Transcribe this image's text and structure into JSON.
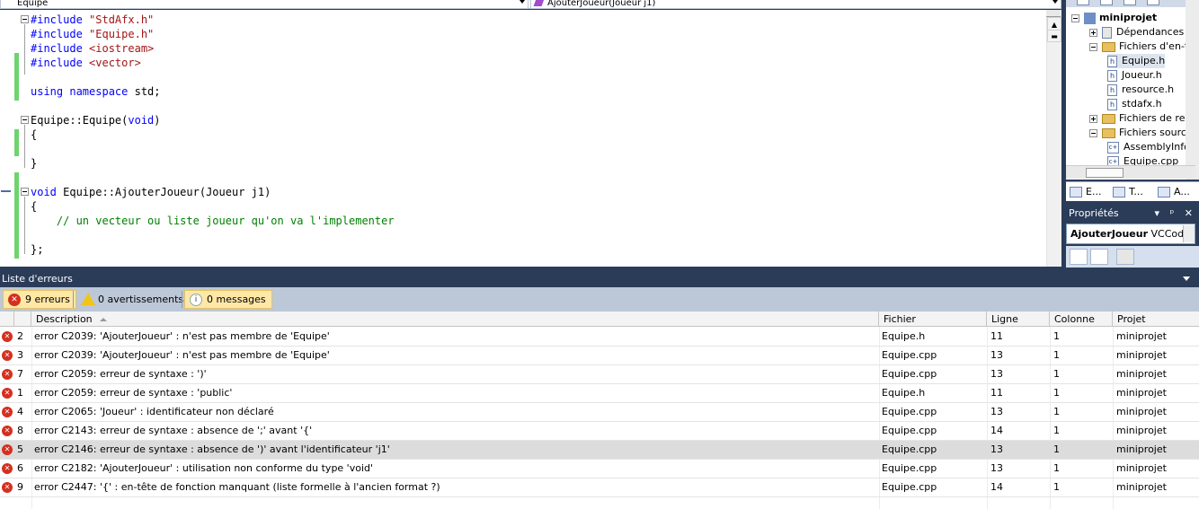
{
  "navbar": {
    "class_combo": "Equipe",
    "member_combo": "AjouterJoueur(Joueur j1)"
  },
  "editor": {
    "lines": [
      [
        {
          "t": "#include ",
          "c": "kw"
        },
        {
          "t": "\"StdAfx.h\"",
          "c": "st"
        }
      ],
      [
        {
          "t": "#include ",
          "c": "kw"
        },
        {
          "t": "\"Equipe.h\"",
          "c": "st"
        }
      ],
      [
        {
          "t": "#include ",
          "c": "kw"
        },
        {
          "t": "<iostream>",
          "c": "st"
        }
      ],
      [
        {
          "t": "#include ",
          "c": "kw"
        },
        {
          "t": "<vector>",
          "c": "st"
        }
      ],
      [],
      [
        {
          "t": "using namespace ",
          "c": "kw"
        },
        {
          "t": "std;",
          "c": ""
        }
      ],
      [],
      [
        {
          "t": "Equipe::Equipe(",
          "c": ""
        },
        {
          "t": "void",
          "c": "kw"
        },
        {
          "t": ")",
          "c": ""
        }
      ],
      [
        {
          "t": "{",
          "c": ""
        }
      ],
      [],
      [
        {
          "t": "}",
          "c": ""
        }
      ],
      [],
      [
        {
          "t": "void",
          "c": "kw"
        },
        {
          "t": " Equipe::AjouterJoueur(Joueur j1)",
          "c": ""
        }
      ],
      [
        {
          "t": "{",
          "c": ""
        }
      ],
      [
        {
          "t": "    // un vecteur ou liste joueur qu'on va l'implementer",
          "c": "cm"
        }
      ],
      [],
      [
        {
          "t": "};",
          "c": ""
        }
      ]
    ]
  },
  "solution_explorer": {
    "nodes": [
      {
        "label": "miniprojet",
        "icon": "solution-icon",
        "exp": "m",
        "bold": true
      },
      {
        "label": "Dépendances",
        "icon": "references-icon",
        "exp": "p"
      },
      {
        "label": "Fichiers d'en-tête",
        "icon": "folder-icon",
        "exp": "m"
      },
      {
        "label": "Equipe.h",
        "icon": "header-file-icon",
        "exp": "",
        "sel": true
      },
      {
        "label": "Joueur.h",
        "icon": "header-file-icon",
        "exp": ""
      },
      {
        "label": "resource.h",
        "icon": "header-file-icon",
        "exp": ""
      },
      {
        "label": "stdafx.h",
        "icon": "header-file-icon",
        "exp": ""
      },
      {
        "label": "Fichiers de ressources",
        "icon": "folder-icon",
        "exp": "p"
      },
      {
        "label": "Fichiers sources",
        "icon": "folder-icon",
        "exp": "m"
      },
      {
        "label": "AssemblyInfo.cpp",
        "icon": "cpp-file-icon",
        "exp": ""
      },
      {
        "label": "Equipe.cpp",
        "icon": "cpp-file-icon",
        "exp": ""
      }
    ],
    "tabs": [
      "E...",
      "T...",
      "A..."
    ]
  },
  "properties": {
    "title": "Propriétés",
    "title_buttons": "▾ ᵖ ✕",
    "object_name": "AjouterJoueur",
    "object_type": "VCCodeFunction"
  },
  "error_list": {
    "title": "Liste d'erreurs",
    "filters": {
      "errors": "9 erreurs",
      "warnings": "0 avertissements",
      "messages": "0 messages"
    },
    "columns": [
      "Description",
      "Fichier",
      "Ligne",
      "Colonne",
      "Projet"
    ],
    "rows": [
      {
        "n": "2",
        "desc": "error C2039: 'AjouterJoueur' : n'est pas membre de 'Equipe'",
        "file": "Equipe.h",
        "line": "11",
        "col": "1",
        "proj": "miniprojet"
      },
      {
        "n": "3",
        "desc": "error C2039: 'AjouterJoueur' : n'est pas membre de 'Equipe'",
        "file": "Equipe.cpp",
        "line": "13",
        "col": "1",
        "proj": "miniprojet"
      },
      {
        "n": "7",
        "desc": "error C2059: erreur de syntaxe : ')'",
        "file": "Equipe.cpp",
        "line": "13",
        "col": "1",
        "proj": "miniprojet"
      },
      {
        "n": "1",
        "desc": "error C2059: erreur de syntaxe : 'public'",
        "file": "Equipe.h",
        "line": "11",
        "col": "1",
        "proj": "miniprojet"
      },
      {
        "n": "4",
        "desc": "error C2065: 'Joueur' : identificateur non déclaré",
        "file": "Equipe.cpp",
        "line": "13",
        "col": "1",
        "proj": "miniprojet"
      },
      {
        "n": "8",
        "desc": "error C2143: erreur de syntaxe : absence de ';' avant '{'",
        "file": "Equipe.cpp",
        "line": "14",
        "col": "1",
        "proj": "miniprojet"
      },
      {
        "n": "5",
        "desc": "error C2146: erreur de syntaxe : absence de ')' avant l'identificateur 'j1'",
        "file": "Equipe.cpp",
        "line": "13",
        "col": "1",
        "proj": "miniprojet",
        "sel": true
      },
      {
        "n": "6",
        "desc": "error C2182: 'AjouterJoueur' : utilisation non conforme du type 'void'",
        "file": "Equipe.cpp",
        "line": "13",
        "col": "1",
        "proj": "miniprojet"
      },
      {
        "n": "9",
        "desc": "error C2447: '{' : en-tête de fonction manquant (liste formelle à l'ancien format ?)",
        "file": "Equipe.cpp",
        "line": "14",
        "col": "1",
        "proj": "miniprojet"
      }
    ]
  },
  "colors": {
    "panel_title": "#2b3c59",
    "keyword": "#0000ff",
    "string": "#a31515",
    "comment": "#008000",
    "change_bar": "#6ed46e",
    "error_icon": "#d4301f"
  }
}
